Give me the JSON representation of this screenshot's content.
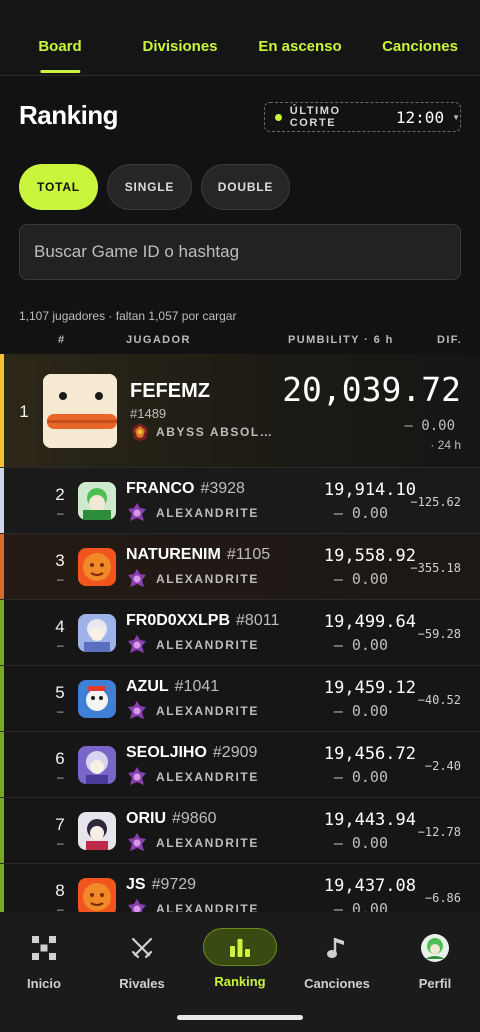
{
  "top_tabs": [
    {
      "label": "Board",
      "active": true
    },
    {
      "label": "Divisiones",
      "active": false
    },
    {
      "label": "En ascenso",
      "active": false
    },
    {
      "label": "Canciones",
      "active": false
    }
  ],
  "header": {
    "title": "Ranking",
    "cutoff_label": "ÚLTIMO CORTE",
    "cutoff_time": "12:00"
  },
  "filters": [
    {
      "label": "TOTAL",
      "active": true
    },
    {
      "label": "SINGLE",
      "active": false
    },
    {
      "label": "DOUBLE",
      "active": false
    }
  ],
  "search": {
    "placeholder": "Buscar Game ID o hashtag",
    "value": ""
  },
  "summary": "1,107 jugadores · faltan 1,057 por cargar",
  "columns": {
    "rank": "#",
    "player": "JUGADOR",
    "score": "PUMBILITY · 6 h",
    "diff": "DIF."
  },
  "leader": {
    "rank": "1",
    "name": "FEFEMZ",
    "tag": "#1489",
    "tier": "ABYSS ABSOL…",
    "score": "20,039.72",
    "delta": "– 0.00",
    "delta_window": "· 24 h"
  },
  "players": [
    {
      "rank": "2",
      "trend": "–",
      "name": "FRANCO",
      "tag": "#3928",
      "tier": "ALEXANDRITE",
      "score": "19,914.10",
      "delta": "– 0.00",
      "diff": "−125.62"
    },
    {
      "rank": "3",
      "trend": "–",
      "name": "NATURENIM",
      "tag": "#1105",
      "tier": "ALEXANDRITE",
      "score": "19,558.92",
      "delta": "– 0.00",
      "diff": "−355.18"
    },
    {
      "rank": "4",
      "trend": "–",
      "name": "FR0D0XXLPB",
      "tag": "#8011",
      "tier": "ALEXANDRITE",
      "score": "19,499.64",
      "delta": "– 0.00",
      "diff": "−59.28"
    },
    {
      "rank": "5",
      "trend": "–",
      "name": "AZUL",
      "tag": "#1041",
      "tier": "ALEXANDRITE",
      "score": "19,459.12",
      "delta": "– 0.00",
      "diff": "−40.52"
    },
    {
      "rank": "6",
      "trend": "–",
      "name": "SEOLJIHO",
      "tag": "#2909",
      "tier": "ALEXANDRITE",
      "score": "19,456.72",
      "delta": "– 0.00",
      "diff": "−2.40"
    },
    {
      "rank": "7",
      "trend": "–",
      "name": "ORIU",
      "tag": "#9860",
      "tier": "ALEXANDRITE",
      "score": "19,443.94",
      "delta": "– 0.00",
      "diff": "−12.78"
    },
    {
      "rank": "8",
      "trend": "–",
      "name": "JS",
      "tag": "#9729",
      "tier": "ALEXANDRITE",
      "score": "19,437.08",
      "delta": "– 0.00",
      "diff": "−6.86"
    }
  ],
  "bottom_nav": [
    {
      "label": "Inicio",
      "icon": "dice-icon",
      "active": false
    },
    {
      "label": "Rivales",
      "icon": "crossed-swords-icon",
      "active": false
    },
    {
      "label": "Ranking",
      "icon": "bar-chart-icon",
      "active": true
    },
    {
      "label": "Canciones",
      "icon": "music-note-icon",
      "active": false
    },
    {
      "label": "Perfil",
      "icon": "profile-avatar-icon",
      "active": false
    }
  ],
  "colors": {
    "accent": "#c9f53c",
    "background": "#121212",
    "leader_bar": "#f2c233",
    "second_bar": "#cfd6e8",
    "third_bar": "#d86a2a",
    "rest_bar": "#7aa822"
  }
}
